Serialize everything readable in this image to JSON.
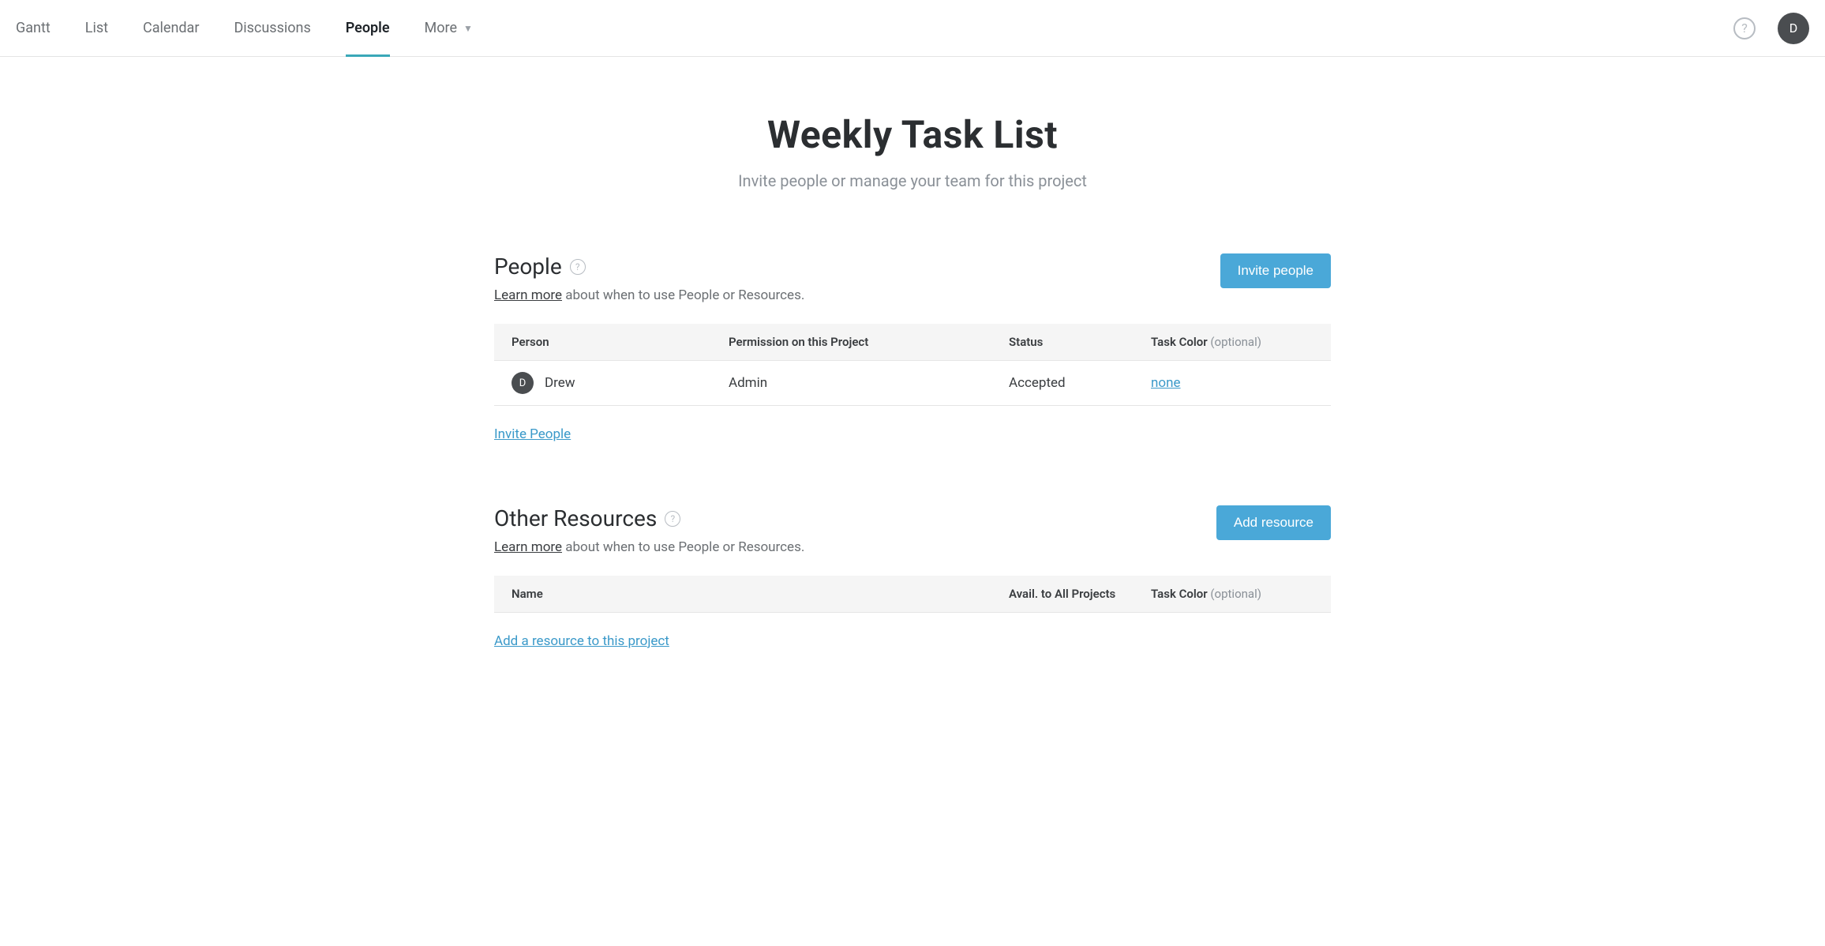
{
  "nav": {
    "tabs": [
      {
        "label": "Gantt",
        "active": false
      },
      {
        "label": "List",
        "active": false
      },
      {
        "label": "Calendar",
        "active": false
      },
      {
        "label": "Discussions",
        "active": false
      },
      {
        "label": "People",
        "active": true
      },
      {
        "label": "More",
        "active": false,
        "has_dropdown": true
      }
    ],
    "avatar_initial": "D"
  },
  "header": {
    "title": "Weekly Task List",
    "subtitle": "Invite people or manage your team for this project"
  },
  "people_section": {
    "title": "People",
    "learn_more_label": "Learn more",
    "learn_more_tail": " about when to use People or Resources.",
    "invite_button": "Invite people",
    "columns": {
      "person": "Person",
      "permission": "Permission on this Project",
      "status": "Status",
      "task_color": "Task Color",
      "task_color_optional": " (optional)"
    },
    "rows": [
      {
        "avatar_initial": "D",
        "name": "Drew",
        "permission": "Admin",
        "status": "Accepted",
        "task_color": "none"
      }
    ],
    "invite_link": "Invite People"
  },
  "resources_section": {
    "title": "Other Resources",
    "learn_more_label": "Learn more",
    "learn_more_tail": " about when to use People or Resources.",
    "add_button": "Add resource",
    "columns": {
      "name": "Name",
      "avail": "Avail. to All Projects",
      "task_color": "Task Color",
      "task_color_optional": " (optional)"
    },
    "add_link": "Add a resource to this project"
  }
}
